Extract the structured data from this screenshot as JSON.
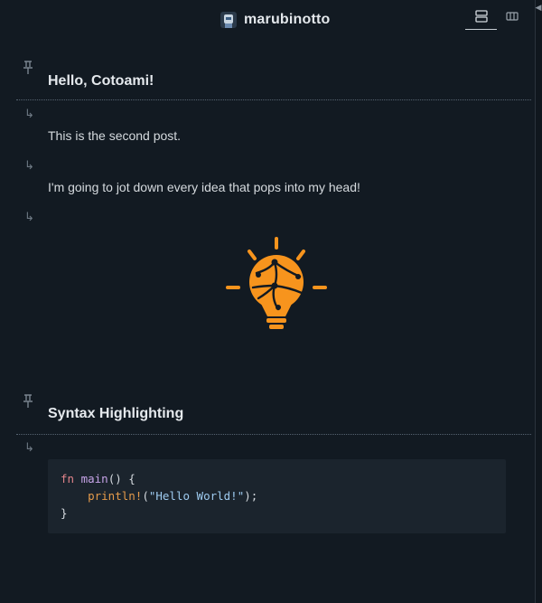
{
  "header": {
    "title": "marubinotto",
    "view_rows_icon": "rows-view-icon",
    "view_columns_icon": "columns-view-icon"
  },
  "posts": [
    {
      "kind": "pinned",
      "heading": "Hello, Cotoami!",
      "icon": "pin-icon"
    },
    {
      "kind": "reply",
      "text": "This is the second post.",
      "icon": "reply-arrow-icon"
    },
    {
      "kind": "reply",
      "text": "I'm going to jot down every idea that pops into my head!",
      "icon": "reply-arrow-icon"
    },
    {
      "kind": "reply",
      "image": "lightbulb-logo",
      "icon": "reply-arrow-icon",
      "color": "#f7941d"
    },
    {
      "kind": "pinned",
      "heading": "Syntax Highlighting",
      "icon": "pin-icon"
    },
    {
      "kind": "reply",
      "icon": "reply-arrow-icon",
      "code": {
        "line1_kw": "fn",
        "line1_name": "main",
        "line1_rest": "() {",
        "line2_macro": "println!",
        "line2_open": "(",
        "line2_string": "\"Hello World!\"",
        "line2_close": ");",
        "line3": "}"
      }
    }
  ],
  "colors": {
    "background": "#121a22",
    "accent": "#f7941d",
    "code_background": "#1b242d"
  }
}
